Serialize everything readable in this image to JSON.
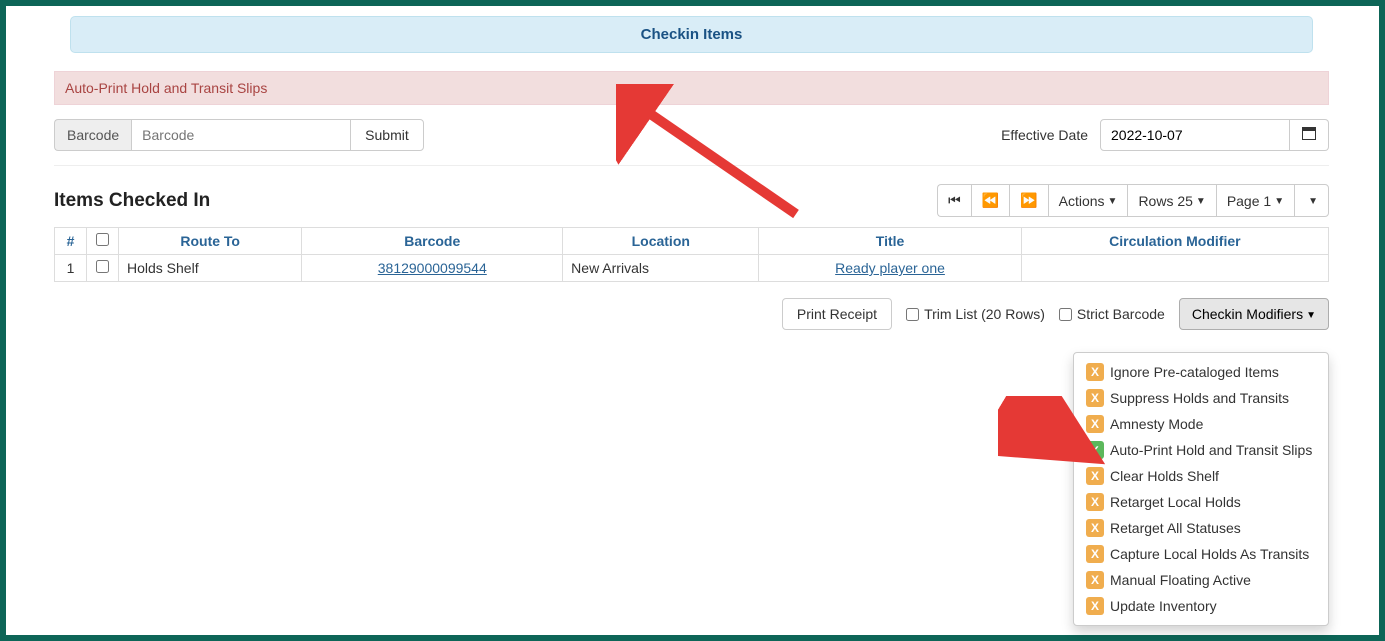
{
  "header": {
    "title": "Checkin Items"
  },
  "alert": {
    "message": "Auto-Print Hold and Transit Slips"
  },
  "barcode": {
    "label": "Barcode",
    "placeholder": "Barcode",
    "submit": "Submit"
  },
  "effective_date": {
    "label": "Effective Date",
    "value": "2022-10-07"
  },
  "items_section": {
    "title": "Items Checked In"
  },
  "toolbar": {
    "actions": "Actions",
    "rows": "Rows 25",
    "page": "Page 1"
  },
  "table": {
    "headers": {
      "num": "#",
      "route": "Route To",
      "barcode": "Barcode",
      "location": "Location",
      "title": "Title",
      "circmod": "Circulation Modifier"
    },
    "rows": [
      {
        "num": "1",
        "route": "Holds Shelf",
        "barcode": "38129000099544",
        "location": "New Arrivals",
        "title": "Ready player one",
        "circmod": ""
      }
    ]
  },
  "below": {
    "print_receipt": "Print Receipt",
    "trim_list": "Trim List (20 Rows)",
    "strict_barcode": "Strict Barcode",
    "checkin_modifiers": "Checkin Modifiers"
  },
  "modifiers": [
    {
      "checked": false,
      "label": "Ignore Pre-cataloged Items"
    },
    {
      "checked": false,
      "label": "Suppress Holds and Transits"
    },
    {
      "checked": false,
      "label": "Amnesty Mode"
    },
    {
      "checked": true,
      "label": "Auto-Print Hold and Transit Slips"
    },
    {
      "checked": false,
      "label": "Clear Holds Shelf"
    },
    {
      "checked": false,
      "label": "Retarget Local Holds"
    },
    {
      "checked": false,
      "label": "Retarget All Statuses"
    },
    {
      "checked": false,
      "label": "Capture Local Holds As Transits"
    },
    {
      "checked": false,
      "label": "Manual Floating Active"
    },
    {
      "checked": false,
      "label": "Update Inventory"
    }
  ]
}
